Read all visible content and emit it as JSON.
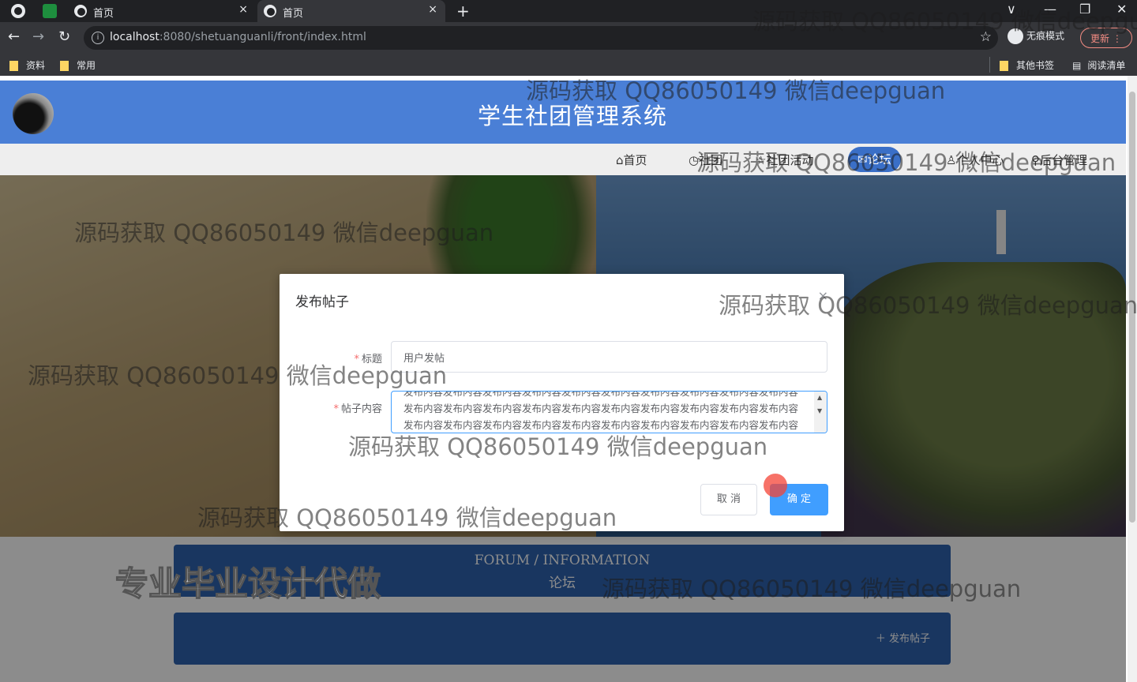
{
  "browser": {
    "tabs": [
      {
        "title": "首页"
      },
      {
        "title": "首页"
      }
    ],
    "tab_close": "×",
    "new_tab": "+",
    "window_controls": [
      "∨",
      "—",
      "❐",
      "✕"
    ],
    "url_host": "localhost",
    "url_rest": ":8080/shetuanguanli/front/index.html",
    "incognito_label": "无痕模式",
    "update_label": "更新",
    "bookmarks": [
      "资料",
      "常用"
    ],
    "bookmarks_right": [
      "其他书签",
      "阅读清单"
    ]
  },
  "site": {
    "title": "学生社团管理系统",
    "nav": [
      {
        "label": "首页",
        "icon": "home-icon"
      },
      {
        "label": "社团",
        "icon": "clock-icon"
      },
      {
        "label": "社团活动",
        "icon": "star-icon"
      },
      {
        "label": "论坛",
        "icon": "chat-icon",
        "active": true
      },
      {
        "label": "个人中心",
        "icon": "user-icon"
      },
      {
        "label": "后台管理",
        "icon": "link-icon"
      }
    ]
  },
  "forum": {
    "heading_en": "FORUM / INFORMATION",
    "heading_zh": "论坛",
    "post_button": "发布帖子"
  },
  "dialog": {
    "title": "发布帖子",
    "close": "×",
    "title_label": "标题",
    "title_value": "用户发帖",
    "content_label": "帖子内容",
    "content_value": "发布内容发布内容发布内容发布内容发布内容发布内容发布内容发布内容发布内容发布内容发布内容发布内容发布内容发布内容发布内容发布内容发布内容发布内容发布内容发布内容发布内容发布内容发布内容发布内容发布内容发布内容发布内容发布内容发布内容发布内容",
    "cancel": "取 消",
    "confirm": "确 定",
    "required_mark": "*"
  },
  "watermarks": {
    "text": "源码获取 QQ86050149 微信deepguan",
    "big": "专业毕业设计代做"
  }
}
